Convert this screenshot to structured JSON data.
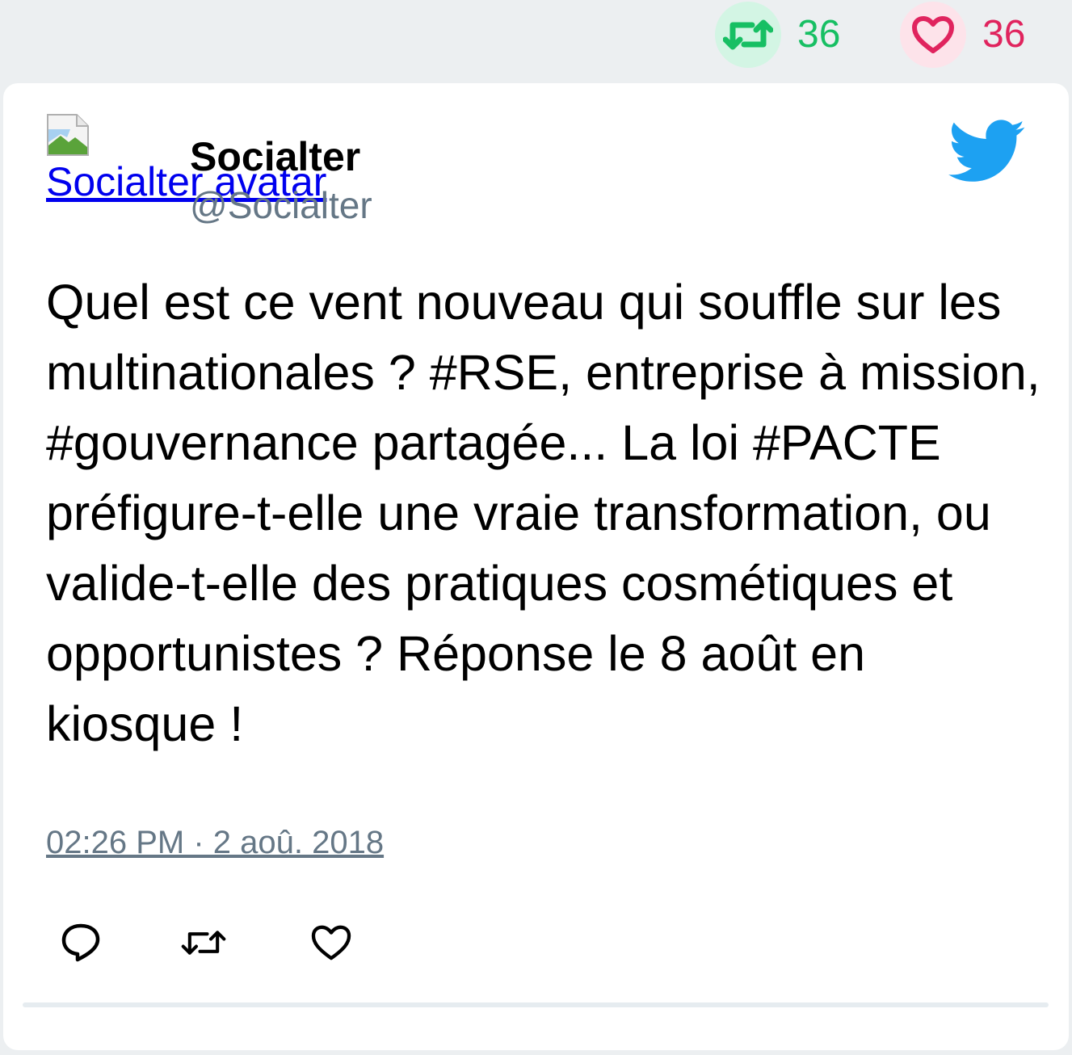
{
  "stats": {
    "retweets": "36",
    "likes": "36"
  },
  "colors": {
    "retweet": "#17bf63",
    "like": "#e0245e",
    "twitter_blue": "#1da1f2",
    "muted": "#657786"
  },
  "author": {
    "avatar_alt": "Socialter avatar",
    "name": "Socialter",
    "handle": "@Socialter"
  },
  "tweet": {
    "text": "Quel est ce vent nouveau qui souffle sur les multinationales ? #RSE, entreprise à mission, #gouvernance partagée... La loi #PACTE préfigure-t-elle une vraie transformation, ou valide-t-elle des pratiques cosmétiques et opportunistes ? Réponse le 8 août en kiosque !",
    "timestamp": "02:26 PM · 2 aoû. 2018"
  },
  "icons": {
    "brand": "twitter-bird-icon",
    "reply": "reply-icon",
    "retweet": "retweet-icon",
    "like": "heart-icon"
  }
}
